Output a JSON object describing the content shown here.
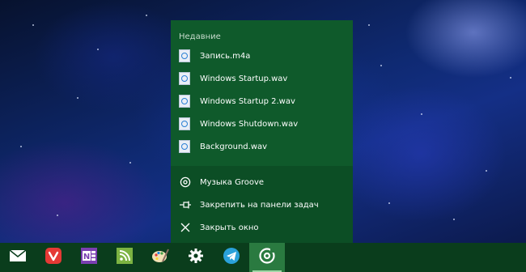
{
  "jumplist": {
    "recent_title": "Недавние",
    "recent_items": [
      {
        "label": "Запись.m4a",
        "icon": "audio-file-icon"
      },
      {
        "label": "Windows Startup.wav",
        "icon": "audio-file-icon"
      },
      {
        "label": "Windows Startup 2.wav",
        "icon": "audio-file-icon"
      },
      {
        "label": "Windows Shutdown.wav",
        "icon": "audio-file-icon"
      },
      {
        "label": "Background.wav",
        "icon": "audio-file-icon"
      }
    ],
    "tasks": [
      {
        "label": "Музыка Groove",
        "icon": "groove-music-icon"
      },
      {
        "label": "Закрепить на панели задач",
        "icon": "pin-icon"
      },
      {
        "label": "Закрыть окно",
        "icon": "close-icon"
      }
    ]
  },
  "taskbar": {
    "apps": [
      {
        "name": "mail-icon"
      },
      {
        "name": "vivaldi-icon"
      },
      {
        "name": "onenote-icon"
      },
      {
        "name": "rss-reader-icon"
      },
      {
        "name": "paint-icon"
      },
      {
        "name": "settings-gear-icon"
      },
      {
        "name": "telegram-icon"
      },
      {
        "name": "groove-music-icon",
        "active": true
      }
    ]
  },
  "colors": {
    "menu_bg": "#0f5a2b",
    "menu_lower_bg": "#0c4e25",
    "taskbar_bg": "#0a3d1c",
    "active_app_bg": "#2a7a40"
  }
}
